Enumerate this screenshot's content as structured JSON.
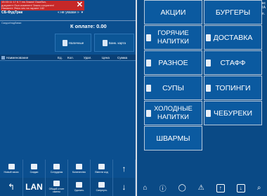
{
  "alert": {
    "lines": [
      "15:33:11 17 6.7 ms Заказ! Ошибка,",
      "документ был изменен/ Заказ сохранен!",
      "Нажмите Фиск.чек на экране 182"
    ],
    "close": "✕"
  },
  "header": {
    "app_title": "СБ-ФудТрак",
    "table_selector": "« не указан »",
    "brand_line1": "СофтБаланс",
    "brand_line2": "ПРОДАЖА",
    "guests": "1 чел.",
    "note": "Скидки/надбавки"
  },
  "payment": {
    "to_pay": "К оплате: 0.00",
    "cash_label": "Наличные",
    "card_label": "Банк. карта"
  },
  "table": {
    "columns": [
      "Наименование",
      "Ед.",
      "Кол.",
      "Удал.",
      "Цена",
      "Сумма"
    ]
  },
  "toolbar_row1": [
    {
      "label": "Новый заказ",
      "icon": "new-order-icon"
    },
    {
      "label": "Скидки",
      "icon": "discount-icon"
    },
    {
      "label": "Сотрудник",
      "icon": "employee-icon"
    },
    {
      "label": "Количество",
      "icon": "quantity-icon"
    },
    {
      "label": "Ввести код",
      "icon": "barcode-icon"
    },
    {
      "label": "↑",
      "icon": "arrow-up-icon"
    }
  ],
  "toolbar_row2": [
    {
      "label": "↰",
      "icon": "back-icon"
    },
    {
      "label": "LAN",
      "icon": "lan-icon"
    },
    {
      "label": "Общий отчет смены",
      "icon": "report-icon"
    },
    {
      "label": "Удалить",
      "icon": "delete-icon"
    },
    {
      "label": "Свернуть",
      "icon": "collapse-icon"
    },
    {
      "label": "↓",
      "icon": "arrow-down-icon"
    }
  ],
  "categories": [
    {
      "label": "АКЦИИ"
    },
    {
      "label": "БУРГЕРЫ"
    },
    {
      "label": "ГОРЯЧИЕ НАПИТКИ"
    },
    {
      "label": "ДОСТАВКА"
    },
    {
      "label": "РАЗНОЕ"
    },
    {
      "label": "СТАФФ"
    },
    {
      "label": "СУПЫ"
    },
    {
      "label": "ТОПИНГИ"
    },
    {
      "label": "ХОЛОДНЫЕ НАПИТКИ"
    },
    {
      "label": "ЧЕБУРЕКИ"
    },
    {
      "label": "ШВАРМЫ"
    }
  ],
  "bottom_icons": [
    "home-icon",
    "info-icon",
    "chat-icon",
    "warning-icon",
    "arrow-up-icon",
    "arrow-down-icon",
    "zoom-icon"
  ],
  "colors": {
    "background": "#0a4d8a",
    "alert": "#c62828",
    "button": "#0b5aa0",
    "divider": "#d8dde6"
  }
}
